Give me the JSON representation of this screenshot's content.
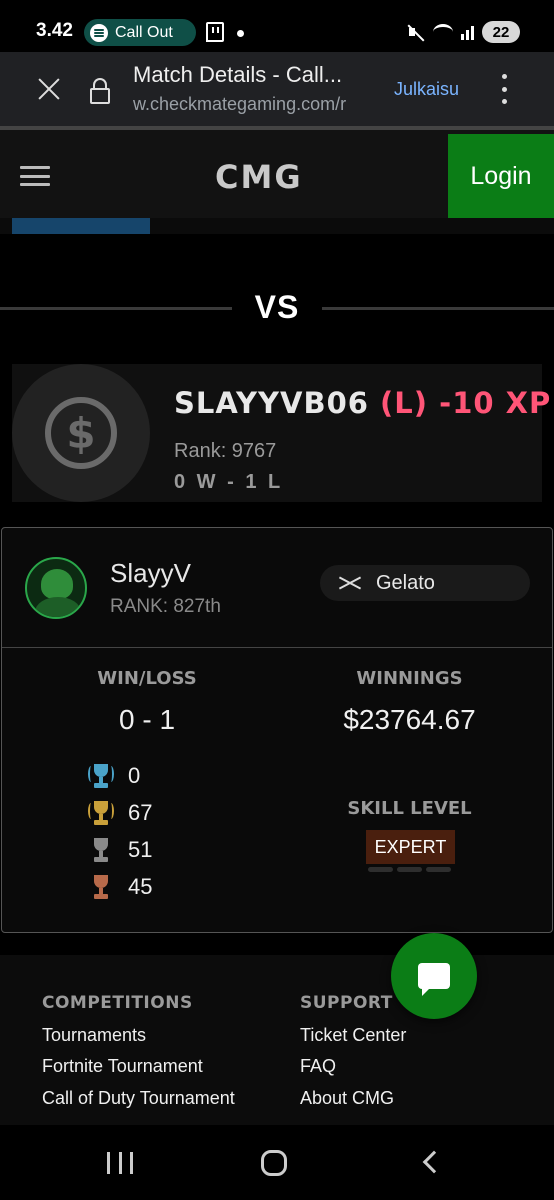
{
  "status_bar": {
    "time": "3.42",
    "media_pill": "Call Out",
    "battery": "22",
    "icons": [
      "spotify-icon",
      "twitch-icon",
      "mute-icon",
      "wifi-icon",
      "signal-icon",
      "battery-icon"
    ]
  },
  "browser": {
    "title": "Match Details - Call...",
    "url": "w.checkmategaming.com/r",
    "action": "Julkaisu"
  },
  "header": {
    "logo": "CMG",
    "login_label": "Login"
  },
  "vs_label": "VS",
  "opponent": {
    "name": "SLAYYVB06",
    "result": "(L)",
    "xp": "-10 XP",
    "rank": "Rank: 9767",
    "record": "0 W - 1 L",
    "result_color": "#ff5577"
  },
  "player": {
    "name": "SlayyV",
    "rank": "RANK: 827th",
    "map": "Gelato",
    "win_loss_label": "WIN/LOSS",
    "win_loss": "0 - 1",
    "winnings_label": "WINNINGS",
    "winnings": "$23764.67",
    "trophies": [
      {
        "tier": "diamond",
        "count": "0",
        "color": "#4aa3c9"
      },
      {
        "tier": "gold",
        "count": "67",
        "color": "#c9a03a"
      },
      {
        "tier": "silver",
        "count": "51",
        "color": "#8a8a8a"
      },
      {
        "tier": "bronze",
        "count": "45",
        "color": "#b86a4a"
      }
    ],
    "skill_label": "SKILL LEVEL",
    "skill": "EXPERT"
  },
  "footer": {
    "competitions_head": "COMPETITIONS",
    "competitions": [
      "Tournaments",
      "Fortnite Tournament",
      "Call of Duty Tournament"
    ],
    "support_head": "SUPPORT",
    "support": [
      "Ticket Center",
      "FAQ",
      "About CMG"
    ]
  },
  "colors": {
    "accent_green": "#0b7d16",
    "tab_blue": "#16456b"
  }
}
